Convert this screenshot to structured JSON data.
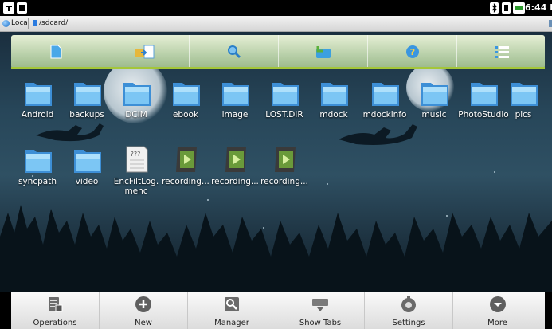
{
  "status": {
    "time": "6:44 P"
  },
  "path": {
    "location": "Local",
    "crumb": "/sdcard/"
  },
  "files": [
    {
      "name": "Android",
      "type": "folder"
    },
    {
      "name": "backups",
      "type": "folder"
    },
    {
      "name": "DCIM",
      "type": "folder"
    },
    {
      "name": "ebook",
      "type": "folder"
    },
    {
      "name": "image",
      "type": "folder"
    },
    {
      "name": "LOST.DIR",
      "type": "folder"
    },
    {
      "name": "mdock",
      "type": "folder"
    },
    {
      "name": "mdockinfo",
      "type": "folder"
    },
    {
      "name": "music",
      "type": "folder"
    },
    {
      "name": "PhotoStudio",
      "type": "folder"
    },
    {
      "name": "pics",
      "type": "folder"
    },
    {
      "name": "syncpath",
      "type": "folder"
    },
    {
      "name": "video",
      "type": "folder"
    },
    {
      "name": "EncFiltLog.\nmenc",
      "type": "unknown"
    },
    {
      "name": "recording...",
      "type": "video"
    },
    {
      "name": "recording...",
      "type": "video"
    },
    {
      "name": "recording...",
      "type": "video"
    }
  ],
  "actionbar": [
    "new-file-icon",
    "copy-icon",
    "search-icon",
    "up-folder-icon",
    "help-icon",
    "list-view-icon"
  ],
  "toolbar": [
    {
      "label": "Operations",
      "icon": "operations-icon"
    },
    {
      "label": "New",
      "icon": "new-icon"
    },
    {
      "label": "Manager",
      "icon": "manager-icon"
    },
    {
      "label": "Show Tabs",
      "icon": "show-tabs-icon"
    },
    {
      "label": "Settings",
      "icon": "settings-icon"
    },
    {
      "label": "More",
      "icon": "more-icon"
    }
  ]
}
